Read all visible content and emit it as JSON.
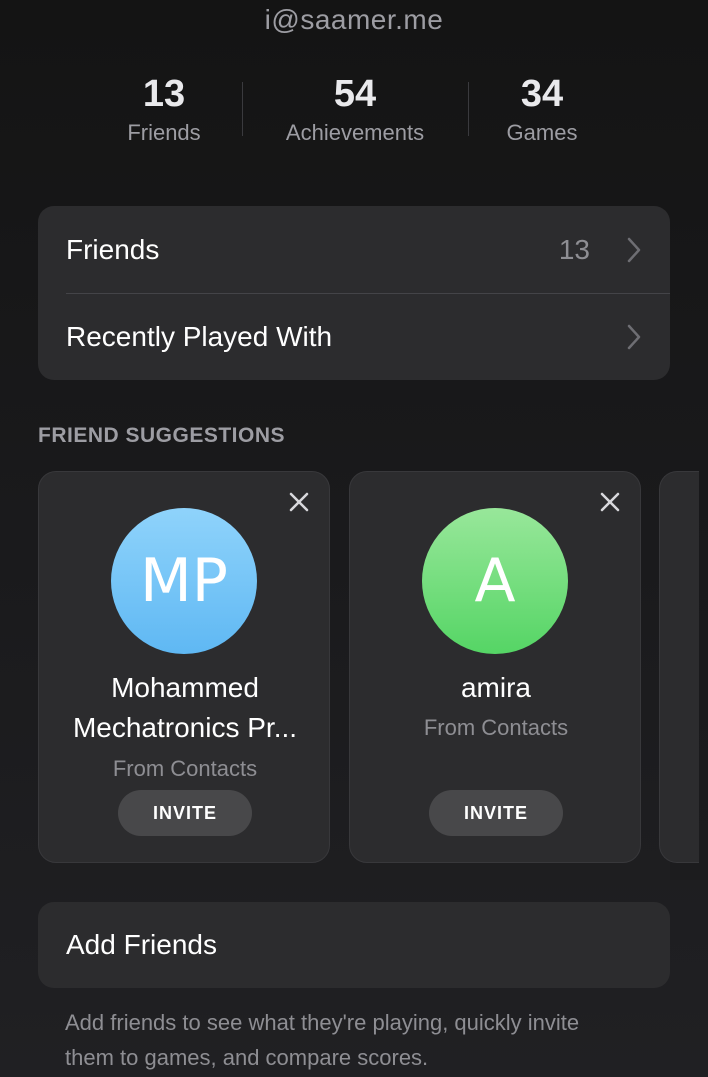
{
  "header": {
    "email": "i@saamer.me"
  },
  "stats": [
    {
      "value": "13",
      "label": "Friends"
    },
    {
      "value": "54",
      "label": "Achievements"
    },
    {
      "value": "34",
      "label": "Games"
    }
  ],
  "list": {
    "friends_label": "Friends",
    "friends_count": "13",
    "recent_label": "Recently Played With"
  },
  "suggestions": {
    "title": "FRIEND SUGGESTIONS",
    "cards": [
      {
        "initials": "MP",
        "name": "Mohammed Mechatronics Pr...",
        "source": "From Contacts",
        "button": "INVITE",
        "avatar_color": "#6cc2f6"
      },
      {
        "initials": "A",
        "name": "amira",
        "source": "From Contacts",
        "button": "INVITE",
        "avatar_color": "#64d96f"
      }
    ]
  },
  "add_friends": {
    "label": "Add Friends",
    "description": "Add friends to see what they're playing, quickly invite them to games, and compare scores."
  },
  "icons": {
    "chevron": "chevron-right-icon",
    "close": "close-icon"
  },
  "colors": {
    "background": "#1c1c1e",
    "card": "#2c2c2e",
    "secondary_text": "#8e8e93",
    "button": "#48484a"
  }
}
